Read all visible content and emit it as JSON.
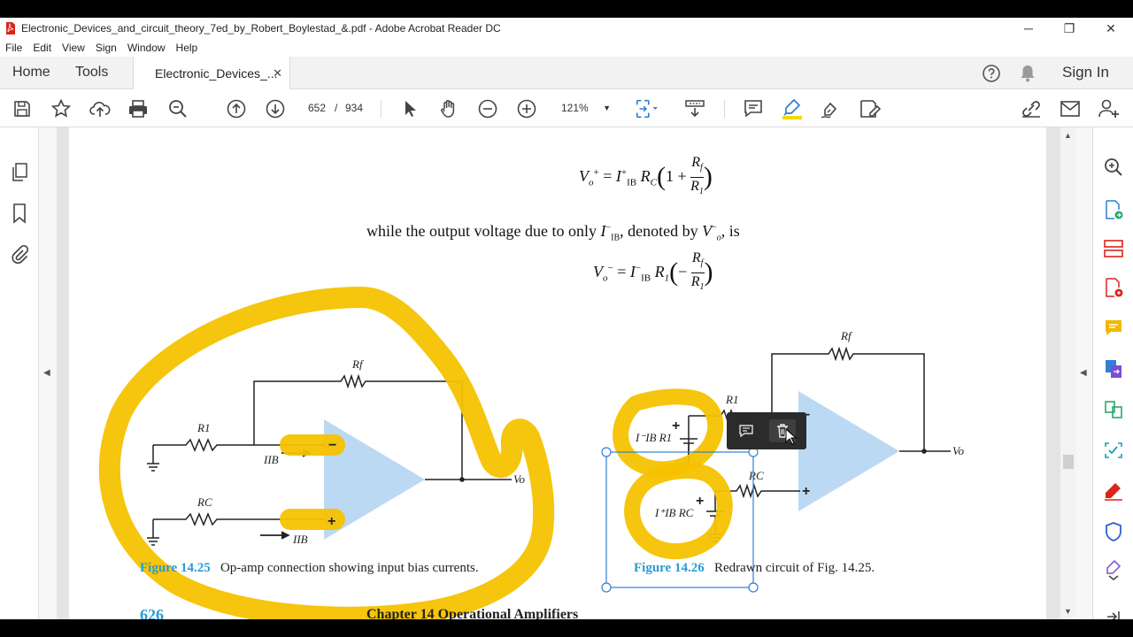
{
  "window": {
    "title": "Electronic_Devices_and_circuit_theory_7ed_by_Robert_Boylestad_&.pdf - Adobe Acrobat Reader DC",
    "controls": [
      "minimize",
      "restore",
      "close"
    ]
  },
  "menubar": [
    "File",
    "Edit",
    "View",
    "Sign",
    "Window",
    "Help"
  ],
  "tabs": {
    "home": "Home",
    "tools": "Tools",
    "document": "Electronic_Devices_...",
    "close_glyph": "✕"
  },
  "header_right": {
    "sign_in": "Sign In"
  },
  "toolbar": {
    "page_current": "652",
    "page_separator": "/",
    "page_total": "934",
    "zoom": "121%"
  },
  "document": {
    "eq1": "V⁺ₒ = I⁺IB RC (1 + Rf / R1)",
    "sentence": "while the output voltage due to only I⁻IB, denoted by V⁻ₒ, is",
    "eq2": "V⁻ₒ = I⁻IB R1 (−Rf / R1)",
    "fig25_label": "Figure 14.25",
    "fig25_caption": "Op-amp connection showing input bias currents.",
    "fig26_label": "Figure 14.26",
    "fig26_caption": "Redrawn circuit of Fig. 14.25.",
    "page_number": "626",
    "footer_chapter": "Chapter 14   Operational Amplifiers",
    "labels": {
      "rf": "Rf",
      "r1": "R1",
      "rc": "RC",
      "iib_minus": "IIB",
      "iib_plus": "IIB",
      "vo": "Vo",
      "minus": "−",
      "plus": "+",
      "src1": "I⁻IB R1",
      "src2": "I⁺IB RC"
    }
  },
  "colors": {
    "highlight": "#f6c200",
    "opamp": "#bcd9f3",
    "caption_blue": "#2a9bd4",
    "selection": "#2f7fd4"
  }
}
